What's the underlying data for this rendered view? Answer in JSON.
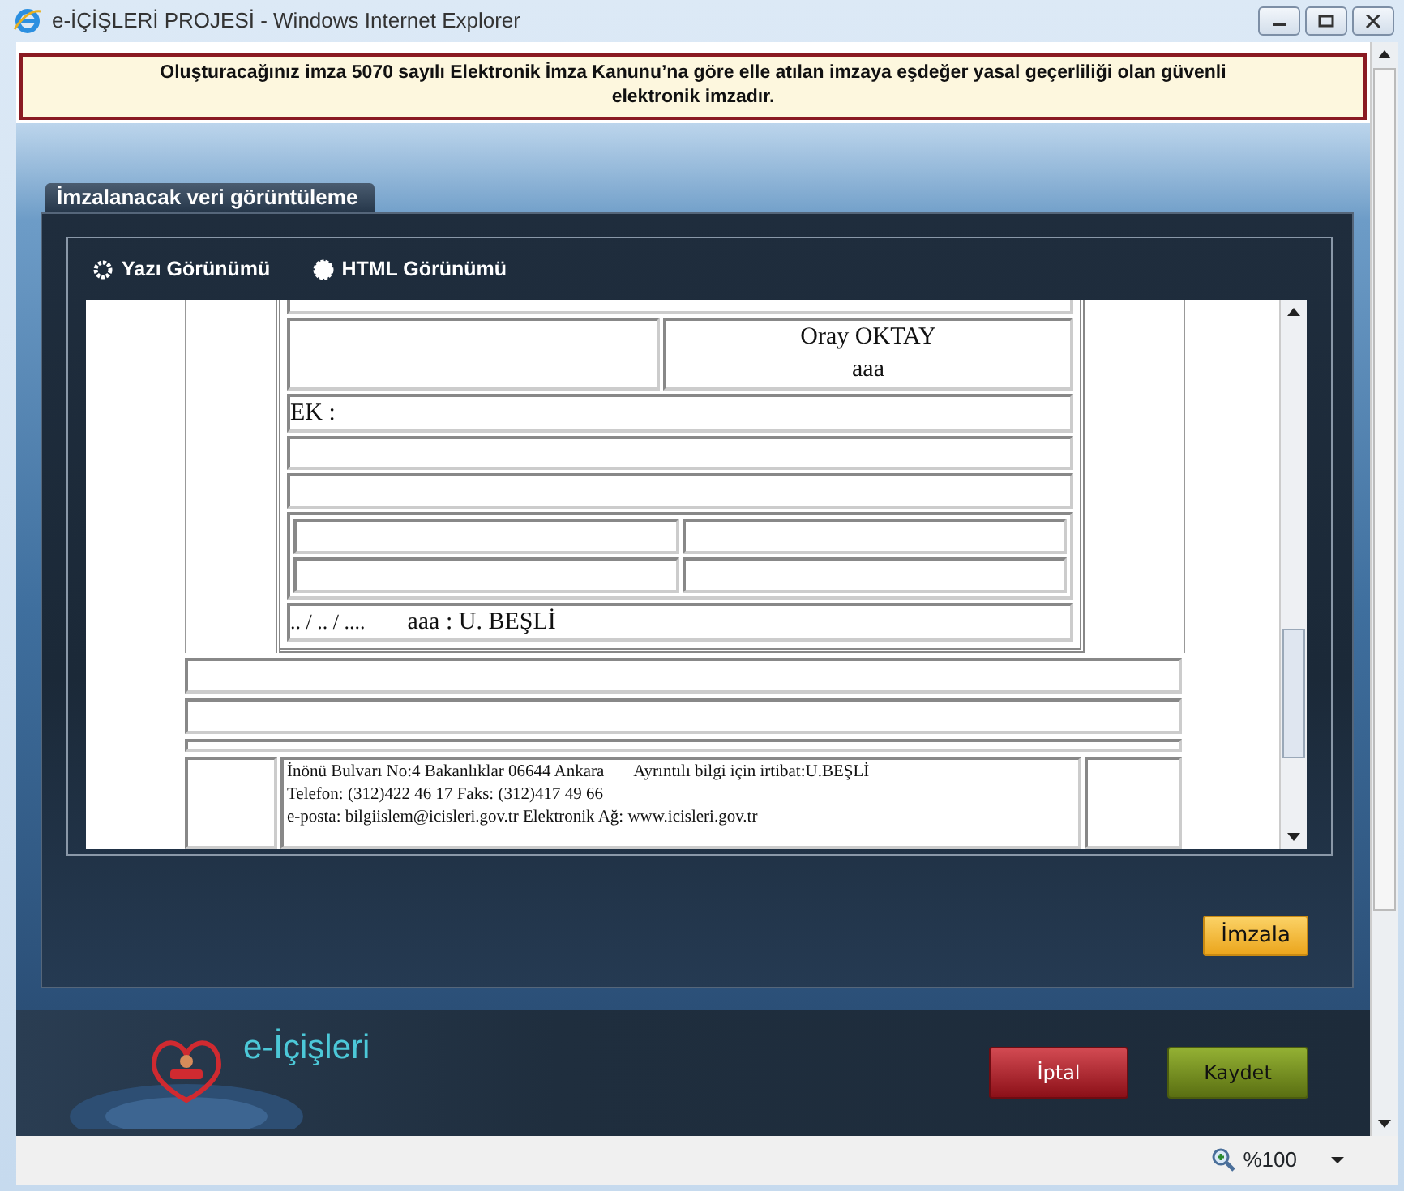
{
  "window": {
    "title": "e-İÇİŞLERİ PROJESİ - Windows Internet Explorer"
  },
  "notice": "Oluşturacağınız imza 5070 sayılı Elektronik İmza Kanunu’na göre elle atılan imzaya eşdeğer yasal geçerliliği olan güvenli elektronik imzadır.",
  "panel_tab": "İmzalanacak veri görüntüleme",
  "view_options": [
    {
      "label": "Yazı Görünümü",
      "selected": false
    },
    {
      "label": "HTML Görünümü",
      "selected": true
    }
  ],
  "document": {
    "signer_name": "Oray OKTAY",
    "signer_title": "aaa",
    "ek_label": "EK :",
    "date_line": ".. / .. / ....",
    "approver": "aaa : U. BEŞLİ",
    "footer_address": "İnönü Bulvarı No:4 Bakanlıklar 06644 Ankara",
    "footer_contact": "Ayrıntılı bilgi için irtibat:U.BEŞLİ",
    "footer_phone": "Telefon: (312)422 46 17 Faks: (312)417 49 66",
    "footer_web": "e-posta: bilgiislem@icisleri.gov.tr Elektronik Ağ: www.icisleri.gov.tr"
  },
  "sign_button": "İmzala",
  "logo_text": "e-İçişleri",
  "cancel_button": "İptal",
  "save_button": "Kaydet",
  "status_bar": {
    "zoom": "%100"
  }
}
